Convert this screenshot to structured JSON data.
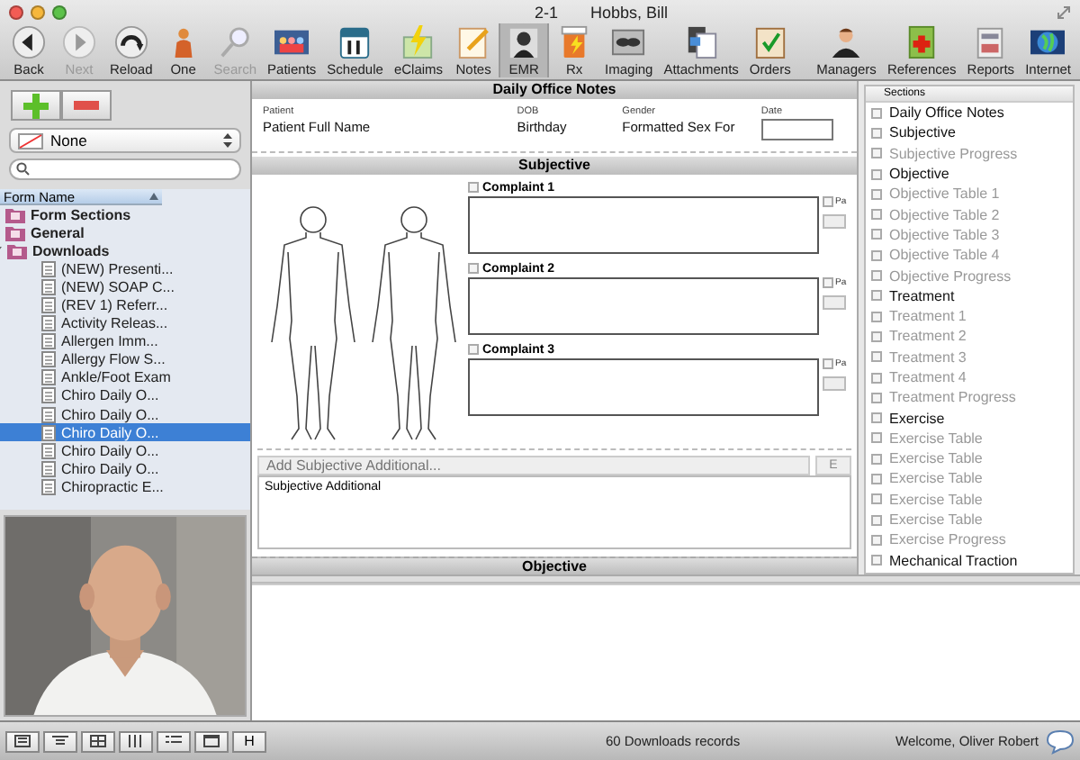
{
  "window": {
    "title_code": "2-1",
    "title_name": "Hobbs, Bill"
  },
  "toolbar": [
    {
      "label": "Back",
      "disabled": false,
      "selected": false
    },
    {
      "label": "Next",
      "disabled": true,
      "selected": false
    },
    {
      "label": "Reload",
      "disabled": false,
      "selected": false
    },
    {
      "label": "One",
      "disabled": false,
      "selected": false
    },
    {
      "label": "Search",
      "disabled": true,
      "selected": false
    },
    {
      "label": "Patients",
      "disabled": false,
      "selected": false
    },
    {
      "label": "Schedule",
      "disabled": false,
      "selected": false
    },
    {
      "label": "eClaims",
      "disabled": false,
      "selected": false
    },
    {
      "label": "Notes",
      "disabled": false,
      "selected": false
    },
    {
      "label": "EMR",
      "disabled": false,
      "selected": true
    },
    {
      "label": "Rx",
      "disabled": false,
      "selected": false
    },
    {
      "label": "Imaging",
      "disabled": false,
      "selected": false
    },
    {
      "label": "Attachments",
      "disabled": false,
      "selected": false
    },
    {
      "label": "Orders",
      "disabled": false,
      "selected": false
    }
  ],
  "toolbar_right": [
    {
      "label": "Managers",
      "disabled": false,
      "selected": false
    },
    {
      "label": "References",
      "disabled": false,
      "selected": false
    },
    {
      "label": "Reports",
      "disabled": false,
      "selected": false
    },
    {
      "label": "Internet",
      "disabled": false,
      "selected": false
    }
  ],
  "sidebar": {
    "filter": {
      "value": "None"
    },
    "tree": {
      "column": "Form Name",
      "items": [
        {
          "label": "Form Sections",
          "selected": false
        },
        {
          "label": "General",
          "selected": false
        },
        {
          "label": "Downloads",
          "selected": false,
          "expanded": true,
          "children": [
            {
              "label": "(NEW) Presenti...",
              "selected": false
            },
            {
              "label": "(NEW) SOAP C...",
              "selected": false
            },
            {
              "label": "(REV 1) Referr...",
              "selected": false
            },
            {
              "label": "Activity Releas...",
              "selected": false
            },
            {
              "label": "Allergen Imm...",
              "selected": false
            },
            {
              "label": "Allergy Flow S...",
              "selected": false
            },
            {
              "label": "Ankle/Foot Exam",
              "selected": false
            },
            {
              "label": "Chiro Daily O...",
              "selected": false
            },
            {
              "label": "Chiro Daily O...",
              "selected": false
            },
            {
              "label": "Chiro Daily O...",
              "selected": true
            },
            {
              "label": "Chiro Daily O...",
              "selected": false
            },
            {
              "label": "Chiro Daily O...",
              "selected": false
            },
            {
              "label": "Chiropractic E...",
              "selected": false
            }
          ]
        }
      ]
    }
  },
  "form": {
    "title": "Daily Office Notes",
    "fields": [
      {
        "label": "Patient",
        "value": "Patient Full Name",
        "kind": "text"
      },
      {
        "label": "DOB",
        "value": "Birthday",
        "kind": "text"
      },
      {
        "label": "Gender",
        "value": "Formatted Sex For",
        "kind": "text"
      },
      {
        "label": "Date",
        "kind": "input"
      }
    ],
    "subjective": {
      "title": "Subjective",
      "complaints": [
        {
          "label": "Complaint 1",
          "checked": false,
          "side_label": "Pa",
          "side_checked": false
        },
        {
          "label": "Complaint 2",
          "checked": false,
          "side_label": "Pa",
          "side_checked": false
        },
        {
          "label": "Complaint 3",
          "checked": false,
          "side_label": "Pa",
          "side_checked": false
        }
      ],
      "additional": {
        "placeholder": "Add Subjective Additional...",
        "button": "E",
        "text": "Subjective Additional"
      }
    },
    "next_section": "Objective"
  },
  "sections_panel": {
    "title": "Sections",
    "items": [
      {
        "label": "Daily Office Notes",
        "kind": "heading",
        "checked": false
      },
      {
        "label": "Subjective",
        "kind": "heading",
        "checked": false
      },
      {
        "label": "Subjective Progress",
        "kind": "sub",
        "checked": false
      },
      {
        "label": "Objective",
        "kind": "heading",
        "checked": false
      },
      {
        "label": "Objective Table 1",
        "kind": "sub",
        "checked": false
      },
      {
        "label": "Objective Table 2",
        "kind": "sub",
        "checked": false
      },
      {
        "label": "Objective Table 3",
        "kind": "sub",
        "checked": false
      },
      {
        "label": "Objective Table 4",
        "kind": "sub",
        "checked": false
      },
      {
        "label": "Objective Progress",
        "kind": "sub",
        "checked": false
      },
      {
        "label": "Treatment",
        "kind": "heading",
        "checked": false
      },
      {
        "label": "Treatment 1",
        "kind": "sub",
        "checked": false
      },
      {
        "label": "Treatment 2",
        "kind": "sub",
        "checked": false
      },
      {
        "label": "Treatment 3",
        "kind": "sub",
        "checked": false
      },
      {
        "label": "Treatment 4",
        "kind": "sub",
        "checked": false
      },
      {
        "label": "Treatment Progress",
        "kind": "sub",
        "checked": false
      },
      {
        "label": "Exercise",
        "kind": "heading",
        "checked": false
      },
      {
        "label": "Exercise Table",
        "kind": "sub",
        "checked": false
      },
      {
        "label": "Exercise Table",
        "kind": "sub",
        "checked": false
      },
      {
        "label": "Exercise Table",
        "kind": "sub",
        "checked": false
      },
      {
        "label": "Exercise Table",
        "kind": "sub",
        "checked": false
      },
      {
        "label": "Exercise Table",
        "kind": "sub",
        "checked": false
      },
      {
        "label": "Exercise Progress",
        "kind": "sub",
        "checked": false
      },
      {
        "label": "Mechanical Traction",
        "kind": "heading",
        "checked": false
      }
    ]
  },
  "status_bar": {
    "h_button": "H",
    "records": "60 Downloads records",
    "welcome": "Welcome, Oliver Robert"
  }
}
